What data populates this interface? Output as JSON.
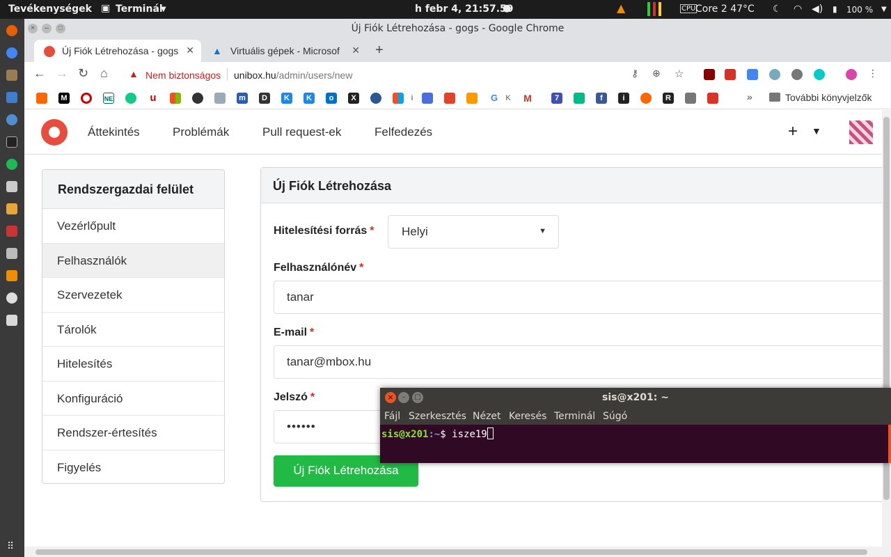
{
  "topbar": {
    "activities": "Tevékenységek",
    "app_menu": "Terminál",
    "clock": "h febr  4, 21:57.59",
    "cpu": "Core 2 47°C",
    "battery": "100 %"
  },
  "window": {
    "title": "Új Fiók Létrehozása - gogs - Google Chrome"
  },
  "tabs": [
    {
      "label": "Új Fiók Létrehozása - gogs"
    },
    {
      "label": "Virtuális gépek - Microsof"
    }
  ],
  "address": {
    "security": "Nem biztonságos",
    "host": "unibox.hu",
    "path": "/admin/users/new"
  },
  "bookmarks": {
    "other": "További könyvjelzők"
  },
  "gogs_nav": {
    "links": [
      "Áttekintés",
      "Problémák",
      "Pull request-ek",
      "Felfedezés"
    ]
  },
  "sidebar": {
    "header": "Rendszergazdai felület",
    "items": [
      {
        "label": "Vezérlőpult"
      },
      {
        "label": "Felhasználók"
      },
      {
        "label": "Szervezetek"
      },
      {
        "label": "Tárolók"
      },
      {
        "label": "Hitelesítés"
      },
      {
        "label": "Konfiguráció"
      },
      {
        "label": "Rendszer-értesítés"
      },
      {
        "label": "Figyelés"
      }
    ]
  },
  "form": {
    "title": "Új Fiók Létrehozása",
    "auth_source_label": "Hitelesítési forrás",
    "auth_source_value": "Helyi",
    "username_label": "Felhasználónév",
    "username_value": "tanar",
    "email_label": "E-mail",
    "email_value": "tanar@mbox.hu",
    "password_label": "Jelszó",
    "password_value": "••••••",
    "submit": "Új Fiók Létrehozása"
  },
  "terminal": {
    "title": "sis@x201: ~",
    "menu": [
      "Fájl",
      "Szerkesztés",
      "Nézet",
      "Keresés",
      "Terminál",
      "Súgó"
    ],
    "prompt_user": "sis@x201",
    "prompt_path": ":~",
    "prompt_symbol": "$ ",
    "command": "isze19"
  },
  "colors": {
    "accent_green": "#21ba45",
    "required_red": "#db2828",
    "gogs_red": "#e74c3c",
    "terminal_bg": "#300a24"
  }
}
